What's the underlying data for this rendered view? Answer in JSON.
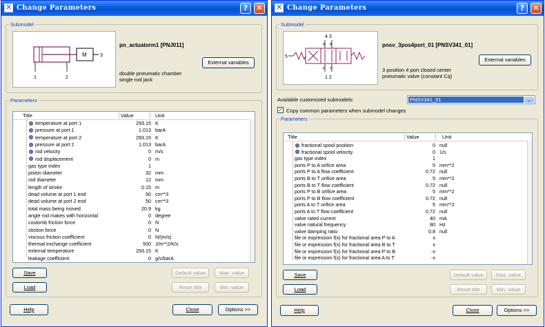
{
  "left": {
    "title": "Change Parameters",
    "submodel_legend": "Submodel",
    "model_name": "pn_actuatorm1 [PNJ011]",
    "desc_line1": "double pneumatic chamber",
    "desc_line2": "single rod jack",
    "ext_vars": "External variables",
    "diagram": {
      "label": "M",
      "port1": "1",
      "port2": "2",
      "port3": "3"
    },
    "params_legend": "Parameters",
    "columns": {
      "title": "Title",
      "value": "Value",
      "unit": "Unit"
    },
    "rows": [
      {
        "title": "temperature at port 1",
        "value": "293.15",
        "unit": "K",
        "icon": true
      },
      {
        "title": "pressure at port 1",
        "value": "1.013",
        "unit": "barA",
        "icon": true
      },
      {
        "title": "temperature at port 2",
        "value": "293.15",
        "unit": "K",
        "icon": true
      },
      {
        "title": "pressure at port 2",
        "value": "1.013",
        "unit": "barA",
        "icon": true
      },
      {
        "title": "rod velocity",
        "value": "0",
        "unit": "m/s",
        "icon": true
      },
      {
        "title": "rod displacement",
        "value": "0",
        "unit": "m",
        "icon": true
      },
      {
        "title": "gas type index",
        "value": "1",
        "unit": "",
        "icon": false
      },
      {
        "title": "piston diameter",
        "value": "32",
        "unit": "mm",
        "icon": false
      },
      {
        "title": "rod diameter",
        "value": "12",
        "unit": "mm",
        "icon": false
      },
      {
        "title": "length of stroke",
        "value": "0.15",
        "unit": "m",
        "icon": false
      },
      {
        "title": "dead volume at port 1 end",
        "value": "50",
        "unit": "cm**3",
        "icon": false
      },
      {
        "title": "dead volume at port 2 end",
        "value": "50",
        "unit": "cm**3",
        "icon": false
      },
      {
        "title": "total mass being moved",
        "value": "20.9",
        "unit": "kg",
        "icon": false
      },
      {
        "title": "angle rod makes with horizontal",
        "value": "0",
        "unit": "degree",
        "icon": false
      },
      {
        "title": "coulomb friction force",
        "value": "0",
        "unit": "N",
        "icon": false
      },
      {
        "title": "stiction force",
        "value": "0",
        "unit": "N",
        "icon": false
      },
      {
        "title": "viscous friction coefficient",
        "value": "0",
        "unit": "N/(m/s)",
        "icon": false
      },
      {
        "title": "thermal exchange coefficient",
        "value": "500",
        "unit": "J/m**2/K/s",
        "icon": false
      },
      {
        "title": "external temperature",
        "value": "293.15",
        "unit": "K",
        "icon": false
      },
      {
        "title": "leakage coefficient",
        "value": "0",
        "unit": "g/s/barA",
        "icon": false
      }
    ],
    "buttons": {
      "save": "Save",
      "load": "Load",
      "default_value": "Default value",
      "max_value": "Max. value",
      "reset_title": "Reset title",
      "min_value": "Min. value",
      "help": "Help",
      "close": "Close",
      "options": "Options >>"
    }
  },
  "right": {
    "title": "Change Parameters",
    "submodel_legend": "Submodel",
    "model_name": "pnsv_3pos4port_01 [PNSV341_01]",
    "desc_line1": "3 position 4 port closed center",
    "desc_line2": "pneumatic valve (constant Cq)",
    "ext_vars": "External variables",
    "diagram": {
      "top": "4 3",
      "bottom": "1 2",
      "left": "5",
      "ta": "A",
      "tb": "B",
      "bp": "P",
      "bt": "T"
    },
    "available_label": "Available customized submodels:",
    "available_value": "PNSV341_01",
    "copy_label": "Copy common parameters when submodel changes",
    "params_legend": "Parameters",
    "columns": {
      "title": "Title",
      "value": "Value",
      "unit": "Unit"
    },
    "rows": [
      {
        "title": "fractional spool position",
        "value": "0",
        "unit": "null",
        "icon": true
      },
      {
        "title": "fractional spool velocity",
        "value": "0",
        "unit": "1/s",
        "icon": true
      },
      {
        "title": "gas type index",
        "value": "1",
        "unit": "",
        "icon": false
      },
      {
        "title": "ports P to A orifice area",
        "value": "5",
        "unit": "mm**2",
        "icon": false
      },
      {
        "title": "ports P to A flow coefficient",
        "value": "0.72",
        "unit": "null",
        "icon": false
      },
      {
        "title": "ports B to T orifice area",
        "value": "5",
        "unit": "mm**2",
        "icon": false
      },
      {
        "title": "ports B to T flow coefficient",
        "value": "0.72",
        "unit": "null",
        "icon": false
      },
      {
        "title": "ports P to B orifice area",
        "value": "5",
        "unit": "mm**2",
        "icon": false
      },
      {
        "title": "ports P to B flow coefficient",
        "value": "0.72",
        "unit": "null",
        "icon": false
      },
      {
        "title": "ports A to T orifice area",
        "value": "5",
        "unit": "mm**2",
        "icon": false
      },
      {
        "title": "ports A to T flow coefficient",
        "value": "0.72",
        "unit": "null",
        "icon": false
      },
      {
        "title": "valve rated current",
        "value": "40",
        "unit": "mA",
        "icon": false
      },
      {
        "title": "valve natural frequency",
        "value": "80",
        "unit": "Hz",
        "icon": false
      },
      {
        "title": "valve damping ratio",
        "value": "0.8",
        "unit": "null",
        "icon": false
      },
      {
        "title": "file or expression f(x) for fractional area P to A",
        "value": "x",
        "unit": "",
        "icon": false
      },
      {
        "title": "file or expression f(x) for fractional area B to T",
        "value": "x",
        "unit": "",
        "icon": false
      },
      {
        "title": "file or expression f(x) for fractional area P to B",
        "value": "-x",
        "unit": "",
        "icon": false
      },
      {
        "title": "file or expression f(x) for fractional area A to T",
        "value": "-x",
        "unit": "",
        "icon": false
      }
    ],
    "buttons": {
      "save": "Save",
      "load": "Load",
      "default_value": "Default value",
      "max_value": "Max. value",
      "reset_title": "Reset title",
      "min_value": "Min. value",
      "help": "Help",
      "close": "Close",
      "options": "Options >>"
    }
  }
}
